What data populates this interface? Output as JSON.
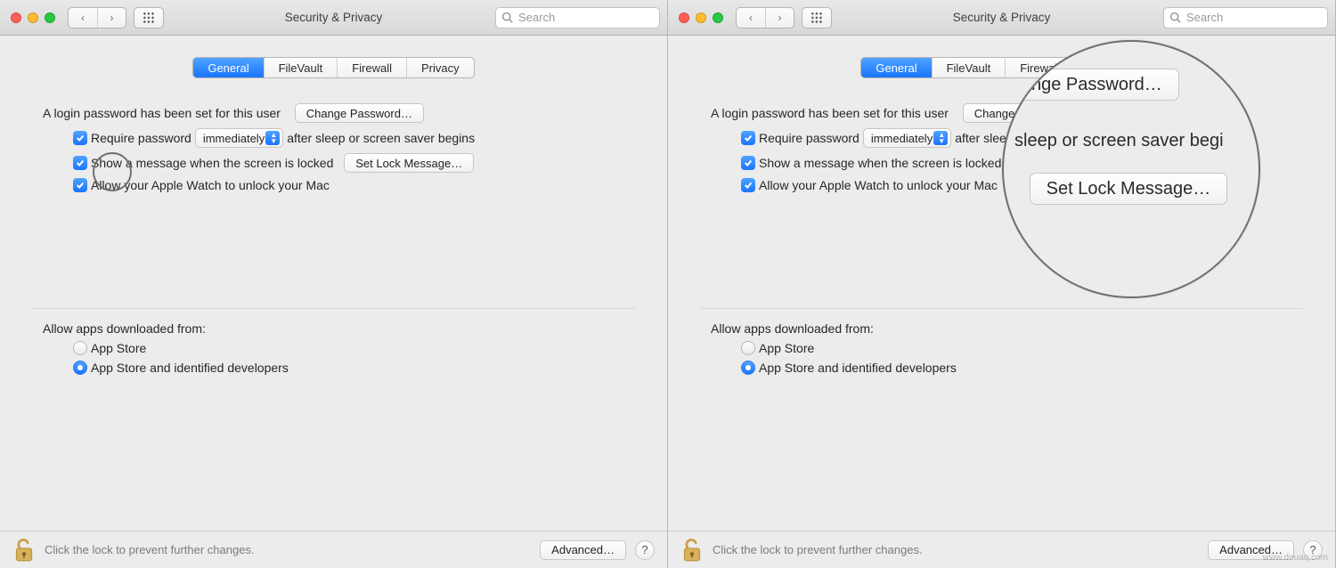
{
  "window": {
    "title": "Security & Privacy",
    "search_placeholder": "Search"
  },
  "nav": {
    "back_icon": "‹",
    "fwd_icon": "›"
  },
  "tabs": {
    "general": "General",
    "filevault": "FileVault",
    "firewall": "Firewall",
    "privacy": "Privacy"
  },
  "general": {
    "login_set_text": "A login password has been set for this user",
    "change_password_btn": "Change Password…",
    "require_pw_label": "Require password",
    "require_pw_delay": "immediately",
    "require_pw_tail": "after sleep or screen saver begins",
    "show_msg_label": "Show a message when the screen is locked",
    "set_lock_msg_btn": "Set Lock Message…",
    "watch_unlock_label": "Allow your Apple Watch to unlock your Mac"
  },
  "gatekeeper": {
    "heading": "Allow apps downloaded from:",
    "opt_appstore": "App Store",
    "opt_identified": "App Store and identified developers"
  },
  "footer": {
    "lock_hint": "Click the lock to prevent further changes.",
    "advanced_btn": "Advanced…",
    "help": "?"
  },
  "magnifier": {
    "change_pw_fragment": "nge Password…",
    "sleep_fragment": "sleep or screen saver begi",
    "set_lock_btn": "Set Lock Message…"
  },
  "watermark": "www.deuaq.com"
}
